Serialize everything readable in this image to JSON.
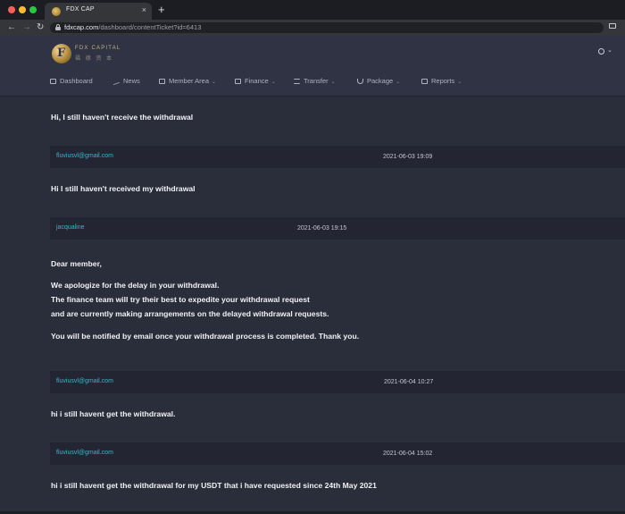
{
  "browser": {
    "tab_title": "FDX CAP",
    "tab_close": "×",
    "new_tab": "+",
    "url_host": "fdxcap.com",
    "url_path": "/dashboard/contentTicket?id=6413"
  },
  "header": {
    "logo_name": "FDX CAPITAL",
    "logo_sub": "福 德 资 本",
    "menu": [
      {
        "label": "Dashboard",
        "icon": "monitor-icon"
      },
      {
        "label": "News",
        "icon": "trend-icon"
      },
      {
        "label": "Member Area",
        "icon": "card-icon"
      },
      {
        "label": "Finance",
        "icon": "edit-icon"
      },
      {
        "label": "Transfer",
        "icon": "list-icon"
      },
      {
        "label": "Package",
        "icon": "anchor-icon"
      },
      {
        "label": "Reports",
        "icon": "report-icon"
      }
    ]
  },
  "thread": {
    "msg1": "Hi, I still haven't receive the withdrawal",
    "entry2": {
      "author": "fluviusvl@gmail.com",
      "time": "2021-06-03 19:09",
      "message": "Hi I still haven't received my withdrawal"
    },
    "entry3": {
      "author": "jacqualine",
      "time": "2021-06-03 19:15",
      "lines": [
        "Dear member,",
        "We apologize for the delay in your withdrawal.",
        "The finance team will try their best to expedite your withdrawal request",
        "and are currently making arrangements on the delayed withdrawal requests.",
        "You will be notified by email once your withdrawal process is completed. Thank you."
      ]
    },
    "entry4": {
      "author": "fluviusvl@gmail.com",
      "time": "2021-06-04 10:27",
      "message": "hi i still havent get the withdrawal."
    },
    "entry5": {
      "author": "fluviusvl@gmail.com",
      "time": "2021-06-04 15:02",
      "message": "hi i still havent get the withdrawal for my USDT that i have requested since 24th May 2021"
    }
  }
}
